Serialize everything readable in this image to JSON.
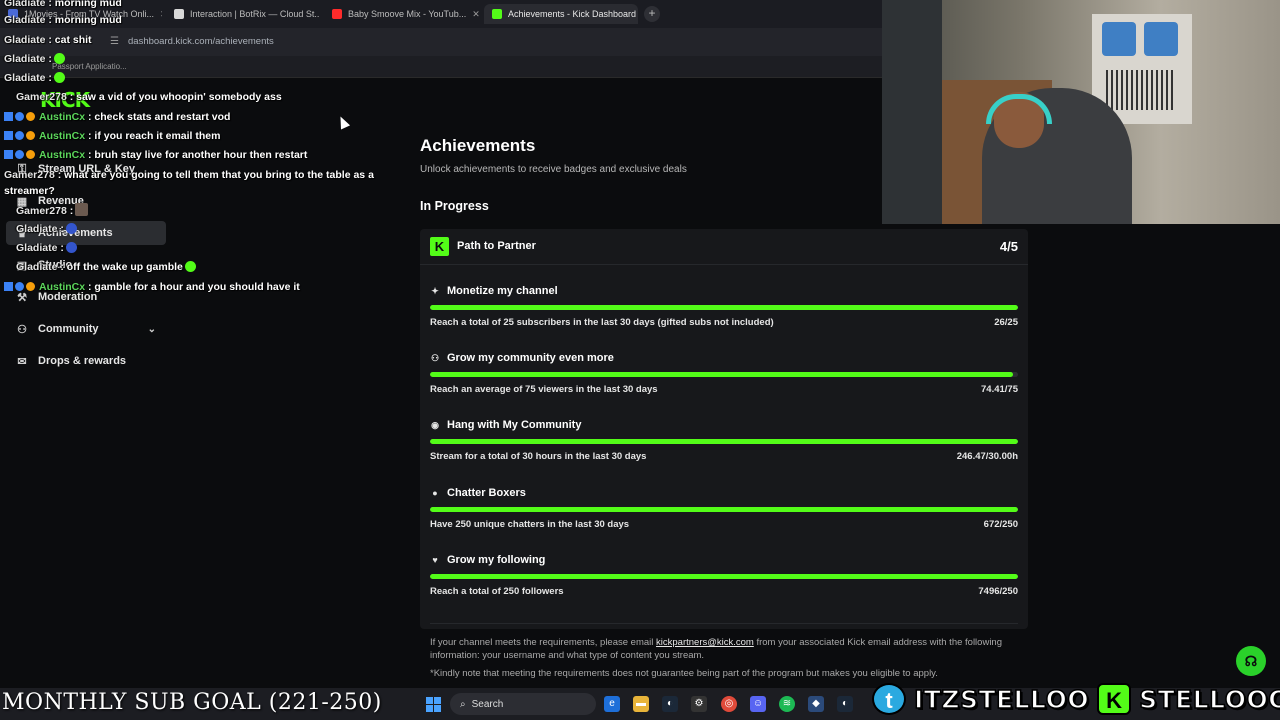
{
  "browser": {
    "tabs": [
      {
        "label": "1Movies - From TV Watch Onli...",
        "favicon_color": "#4a6ad8",
        "active": false
      },
      {
        "label": "Interaction | BotRix — Cloud St...",
        "favicon_color": "#d8d8d8",
        "active": false
      },
      {
        "label": "Baby Smoove Mix - YouTub...",
        "favicon_color": "#ff2b2b",
        "active": false
      },
      {
        "label": "Achievements - Kick Dashboard",
        "favicon_color": "#53fc18",
        "active": true
      }
    ],
    "url": "dashboard.kick.com/achievements",
    "bookmark": "Passport Applicatio..."
  },
  "sidebar": {
    "logo": "KICK",
    "items": [
      {
        "label": "Stream URL & Key",
        "icon": "key-icon"
      },
      {
        "label": "Revenue",
        "icon": "dollar-icon"
      },
      {
        "label": "Achievements",
        "icon": "trophy-icon",
        "selected": true
      },
      {
        "label": "Studio",
        "icon": "studio-icon"
      },
      {
        "label": "Moderation",
        "icon": "hammer-icon"
      },
      {
        "label": "Community",
        "icon": "community-icon",
        "chevron": true
      },
      {
        "label": "Drops & rewards",
        "icon": "gift-icon"
      }
    ]
  },
  "chat": [
    {
      "user": "Gladiate",
      "text": ": morning mud",
      "badges": false
    },
    {
      "user": "Gladiate",
      "text": ": cat shit",
      "badges": false
    },
    {
      "user": "Gladiate",
      "text": ":",
      "badges": false,
      "emote": "green"
    },
    {
      "user": "Gladiate",
      "text": ":",
      "badges": false,
      "emote": "green"
    },
    {
      "user": "Gamer278",
      "text": ": saw a vid of you whoopin' somebody ass",
      "badges": false
    },
    {
      "user": "AustinCx",
      "text": ": check stats and restart vod",
      "badges": true
    },
    {
      "user": "AustinCx",
      "text": ": if you reach it email them",
      "badges": true
    },
    {
      "user": "AustinCx",
      "text": ": bruh stay live for another hour then restart",
      "badges": true
    },
    {
      "user": "Gamer278",
      "text": ": what are you going to tell them that you bring to the table as a streamer?",
      "badges": false
    },
    {
      "user": "Gamer278",
      "text": ":",
      "badges": false,
      "emote": "img"
    },
    {
      "user": "Gladiate",
      "text": ":",
      "badges": false,
      "emote": "blue"
    },
    {
      "user": "Gladiate",
      "text": ":",
      "badges": false,
      "emote": "blue"
    },
    {
      "user": "Gladiate",
      "text": ": off the wake up gamble",
      "badges": false,
      "emote": "green"
    },
    {
      "user": "AustinCx",
      "text": ": gamble for a hour and you should have it",
      "badges": true
    }
  ],
  "page": {
    "title": "Achievements",
    "subtitle": "Unlock achievements to receive badges and exclusive deals",
    "section": "In Progress"
  },
  "card": {
    "badge_letter": "K",
    "title": "Path to Partner",
    "count": "4/5",
    "achievements": [
      {
        "icon": "sparkle-icon",
        "icon_glyph": "✦",
        "title": "Monetize my channel",
        "desc": "Reach a total of 25 subscribers in the last 30 days (gifted subs not included)",
        "value": "26/25",
        "progress": 1.0
      },
      {
        "icon": "community-icon",
        "icon_glyph": "⚇",
        "title": "Grow my community even more",
        "desc": "Reach an average of 75 viewers in the last 30 days",
        "value": "74.41/75",
        "progress": 0.992
      },
      {
        "icon": "broadcast-icon",
        "icon_glyph": "◉",
        "title": "Hang with My Community",
        "desc": "Stream for a total of 30 hours in the last 30 days",
        "value": "246.47/30.00h",
        "progress": 1.0
      },
      {
        "icon": "chat-bubble-icon",
        "icon_glyph": "●",
        "title": "Chatter Boxers",
        "desc": "Have 250 unique chatters in the last 30 days",
        "value": "672/250",
        "progress": 1.0
      },
      {
        "icon": "heart-icon",
        "icon_glyph": "♥",
        "title": "Grow my following",
        "desc": "Reach a total of 250 followers",
        "value": "7496/250",
        "progress": 1.0
      }
    ]
  },
  "note": {
    "before": "If your channel meets the requirements, please email ",
    "email": "kickpartners@kick.com",
    "after": " from your associated Kick email address with the following information: your username and what type of content you stream.",
    "disclaimer": "*Kindly note that meeting the requirements does not guarantee being part of the program but makes you eligible to apply."
  },
  "overlay": {
    "sub_goal": "MONTHLY SUB GOAL (221-250)",
    "twitter_handle": "ITZSTELLOO",
    "kick_handle": "STELLOOO"
  },
  "taskbar": {
    "search_label": "Search"
  },
  "colors": {
    "kick_green": "#53fc18",
    "background": "#0b0c0e",
    "card": "#17181b"
  }
}
